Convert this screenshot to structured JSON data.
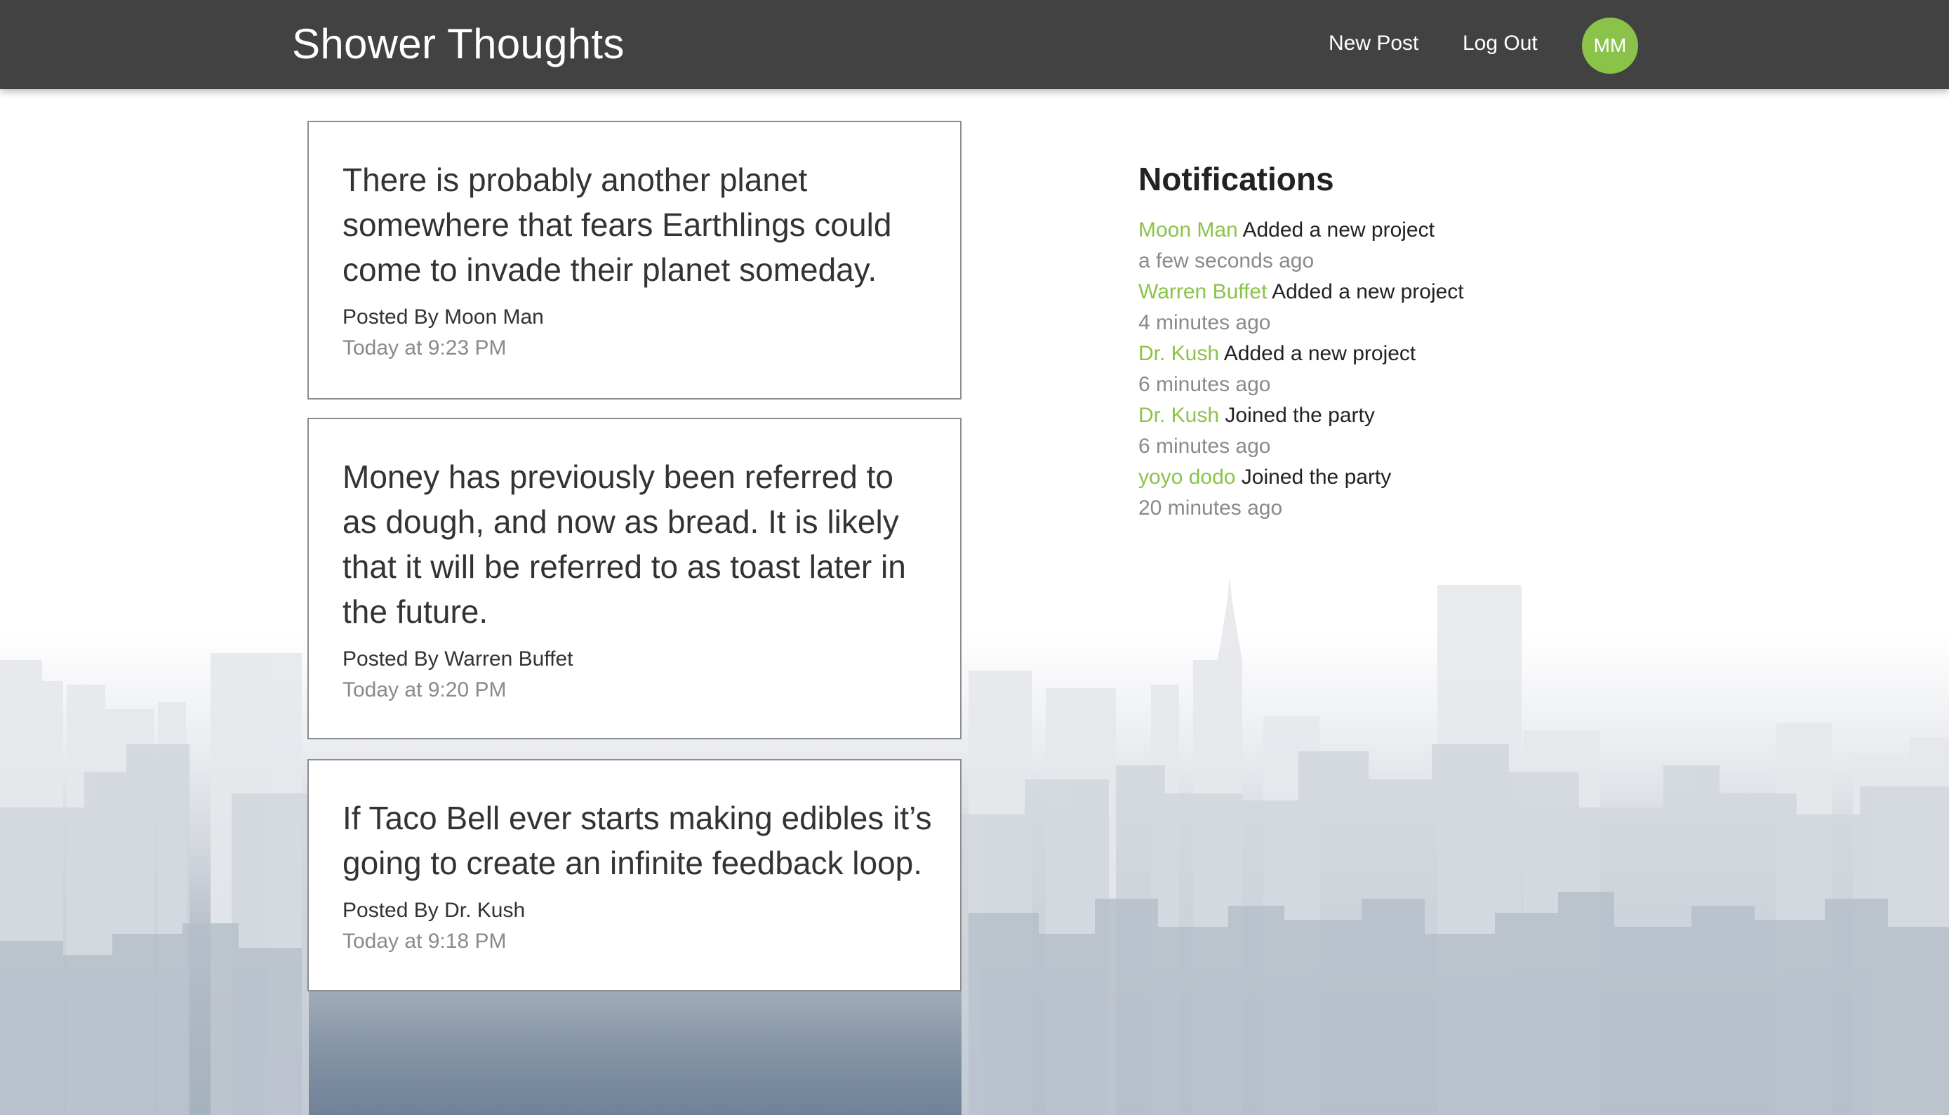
{
  "nav": {
    "brand": "Shower Thoughts",
    "new_post": "New Post",
    "log_out": "Log Out",
    "avatar_initials": "MM",
    "avatar_color": "#8bc34a",
    "bar_color": "#424242"
  },
  "posts": [
    {
      "body": "There is probably another planet somewhere that fears Earthlings could come to invade their planet someday.",
      "author": "Posted By Moon Man",
      "time": "Today at 9:23 PM"
    },
    {
      "body": "Money has previously been referred to as dough, and now as bread. It is likely that it will be referred to as toast later in the future.",
      "author": "Posted By Warren Buffet",
      "time": "Today at 9:20 PM"
    },
    {
      "body": "If Taco Bell ever starts making edibles it’s going to create an infinite feedback loop.",
      "author": "Posted By Dr. Kush",
      "time": "Today at 9:18 PM"
    }
  ],
  "notifications": {
    "title": "Notifications",
    "items": [
      {
        "user": "Moon Man",
        "action": "Added a new project",
        "time": "a few seconds ago"
      },
      {
        "user": "Warren Buffet",
        "action": "Added a new project",
        "time": "4 minutes ago"
      },
      {
        "user": "Dr. Kush",
        "action": "Added a new project",
        "time": "6 minutes ago"
      },
      {
        "user": "Dr. Kush",
        "action": "Joined the party",
        "time": "6 minutes ago"
      },
      {
        "user": "yoyo dodo",
        "action": "Joined the party",
        "time": "20 minutes ago"
      }
    ]
  },
  "colors": {
    "accent": "#8bc34a",
    "muted_text": "#8a8a8a"
  }
}
